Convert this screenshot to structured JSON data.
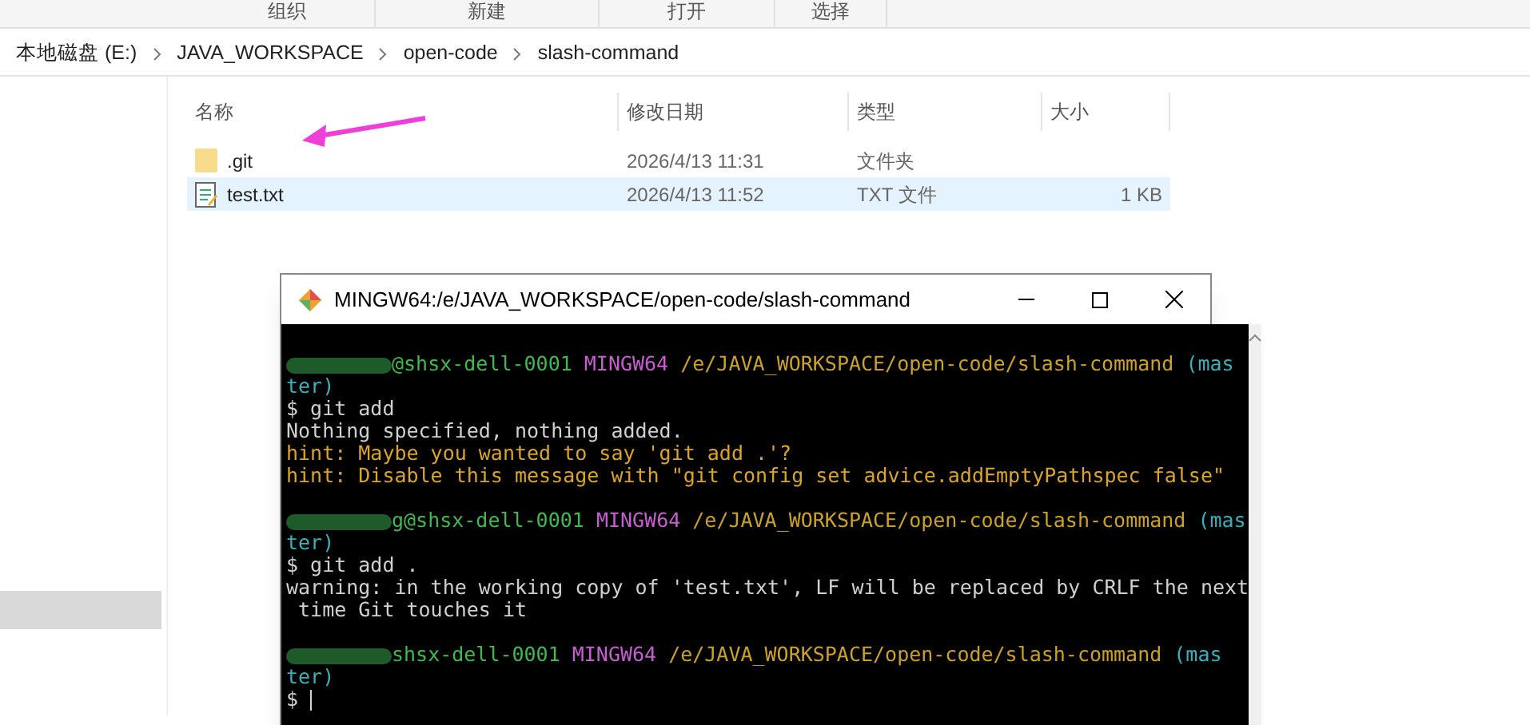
{
  "ribbon": {
    "groups": [
      "组织",
      "新建",
      "打开",
      "选择"
    ]
  },
  "breadcrumb": [
    "本地磁盘 (E:)",
    "JAVA_WORKSPACE",
    "open-code",
    "slash-command"
  ],
  "nav": {
    "items": [
      {
        "selected": true
      }
    ]
  },
  "file_list": {
    "columns": [
      "名称",
      "修改日期",
      "类型",
      "大小"
    ],
    "rows": [
      {
        "kind": "folder",
        "name": ".git",
        "modified": "2026/4/13 11:31",
        "type": "文件夹",
        "selected": false
      },
      {
        "kind": "text",
        "name": "test.txt",
        "modified": "2026/4/13 11:52",
        "type": "TXT 文件",
        "size": "1 KB",
        "selected": true
      }
    ]
  },
  "terminal": {
    "title": "MINGW64:/e/JAVA_WORKSPACE/open-code/slash-command",
    "lines": [
      {
        "kind": "blank"
      },
      {
        "kind": "prompt",
        "host": "@shsx-dell-0001",
        "shell": "MINGW64",
        "path": "/e/JAVA_WORKSPACE/open-code/slash-command",
        "branch": "(mas"
      },
      {
        "kind": "branch",
        "text": "ter)"
      },
      {
        "kind": "output",
        "text": "$ git add"
      },
      {
        "kind": "output",
        "text": "Nothing specified, nothing added."
      },
      {
        "kind": "hint",
        "text": "hint: Maybe you wanted to say 'git add .'?"
      },
      {
        "kind": "hint",
        "text": "hint: Disable this message with \"git config set advice.addEmptyPathspec false\""
      },
      {
        "kind": "blank"
      },
      {
        "kind": "prompt",
        "host": "g@shsx-dell-0001",
        "shell": "MINGW64",
        "path": "/e/JAVA_WORKSPACE/open-code/slash-command",
        "branch": "(mas"
      },
      {
        "kind": "branch",
        "text": "ter)"
      },
      {
        "kind": "output",
        "text": "$ git add ."
      },
      {
        "kind": "output",
        "text": "warning: in the working copy of 'test.txt', LF will be replaced by CRLF the next"
      },
      {
        "kind": "output",
        "text": " time Git touches it"
      },
      {
        "kind": "blank"
      },
      {
        "kind": "prompt",
        "host": "shsx-dell-0001",
        "shell": "MINGW64",
        "path": "/e/JAVA_WORKSPACE/open-code/slash-command",
        "branch": "(mas"
      },
      {
        "kind": "branch",
        "text": "ter)"
      },
      {
        "kind": "input",
        "text": "$"
      }
    ]
  }
}
